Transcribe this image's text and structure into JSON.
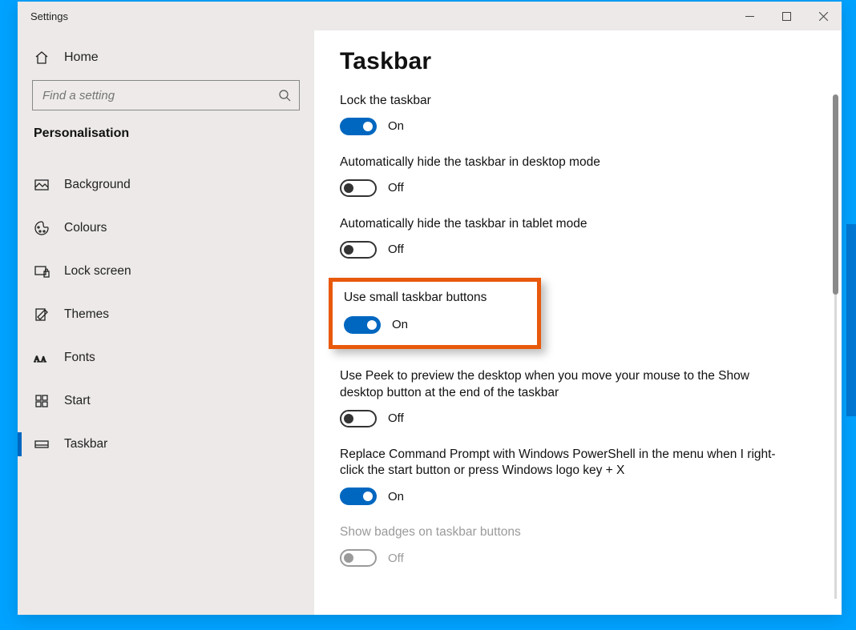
{
  "window": {
    "title": "Settings"
  },
  "sidebar": {
    "home": "Home",
    "search_placeholder": "Find a setting",
    "category": "Personalisation",
    "items": [
      {
        "label": "Background",
        "icon": "background",
        "selected": false
      },
      {
        "label": "Colours",
        "icon": "colours",
        "selected": false
      },
      {
        "label": "Lock screen",
        "icon": "lockscreen",
        "selected": false
      },
      {
        "label": "Themes",
        "icon": "themes",
        "selected": false
      },
      {
        "label": "Fonts",
        "icon": "fonts",
        "selected": false
      },
      {
        "label": "Start",
        "icon": "start",
        "selected": false
      },
      {
        "label": "Taskbar",
        "icon": "taskbar",
        "selected": true
      }
    ]
  },
  "main": {
    "title": "Taskbar",
    "state_on": "On",
    "state_off": "Off",
    "settings": [
      {
        "label": "Lock the taskbar",
        "on": true,
        "disabled": false,
        "highlight": false
      },
      {
        "label": "Automatically hide the taskbar in desktop mode",
        "on": false,
        "disabled": false,
        "highlight": false
      },
      {
        "label": "Automatically hide the taskbar in tablet mode",
        "on": false,
        "disabled": false,
        "highlight": false
      },
      {
        "label": "Use small taskbar buttons",
        "on": true,
        "disabled": false,
        "highlight": true
      },
      {
        "label": "Use Peek to preview the desktop when you move your mouse to the Show desktop button at the end of the taskbar",
        "on": false,
        "disabled": false,
        "highlight": false
      },
      {
        "label": "Replace Command Prompt with Windows PowerShell in the menu when I right-click the start button or press Windows logo key + X",
        "on": true,
        "disabled": false,
        "highlight": false
      },
      {
        "label": "Show badges on taskbar buttons",
        "on": false,
        "disabled": true,
        "highlight": false
      }
    ]
  }
}
